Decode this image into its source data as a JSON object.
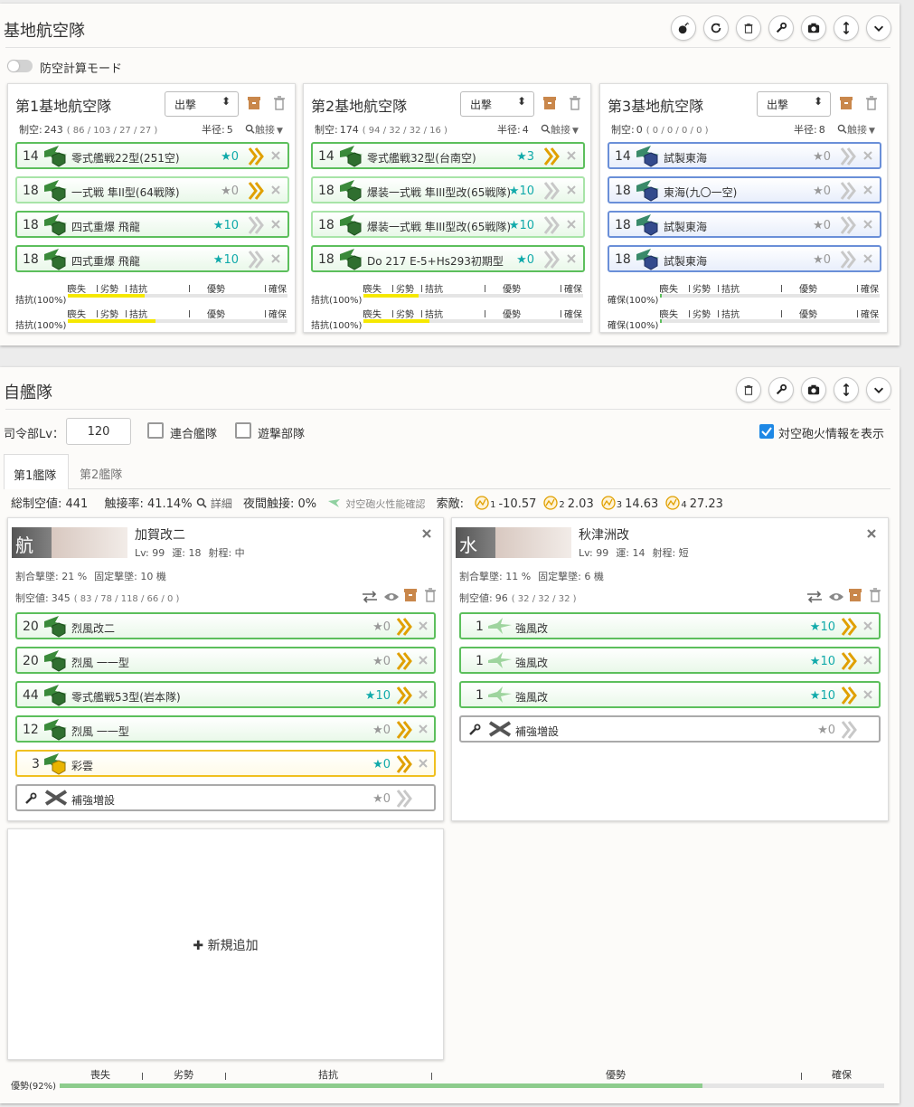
{
  "lbas": {
    "title": "基地航空隊",
    "aa_mode_label": "防空計算モード",
    "bases": [
      {
        "title": "第1基地航空隊",
        "mode": "出撃",
        "air_label": "制空:",
        "air": "243",
        "air_sub": "( 86 / 103 / 27 / 27 )",
        "radius_label": "半径:",
        "radius": "5",
        "contact": "触接",
        "slots": [
          {
            "count": "14",
            "name": "零式艦戦22型(251空)",
            "star": "★0",
            "type": "fighter",
            "tag": "戦"
          },
          {
            "count": "18",
            "name": "一式戦 隼II型(64戦隊)",
            "star": "★0",
            "type": "fighter",
            "tag": "陸"
          },
          {
            "count": "18",
            "name": "四式重爆 飛龍",
            "star": "★10",
            "type": "bomber",
            "tag": "陸"
          },
          {
            "count": "18",
            "name": "四式重爆 飛龍",
            "star": "★10",
            "type": "bomber",
            "tag": "陸"
          }
        ],
        "gauges": [
          {
            "status": "拮抗(100%)",
            "fill": 0.35
          },
          {
            "status": "拮抗(100%)",
            "fill": 0.4
          }
        ]
      },
      {
        "title": "第2基地航空隊",
        "mode": "出撃",
        "air_label": "制空:",
        "air": "174",
        "air_sub": "( 94 / 32 / 32 / 16 )",
        "radius_label": "半径:",
        "radius": "4",
        "contact": "触接",
        "slots": [
          {
            "count": "14",
            "name": "零式艦戦32型(台南空)",
            "star": "★3",
            "type": "fighter",
            "tag": "戦"
          },
          {
            "count": "18",
            "name": "爆装一式戦 隼III型改(65戦隊)",
            "star": "★10",
            "type": "fighter",
            "tag": "陸"
          },
          {
            "count": "18",
            "name": "爆装一式戦 隼III型改(65戦隊)",
            "star": "★10",
            "type": "fighter",
            "tag": "陸"
          },
          {
            "count": "18",
            "name": "Do 217 E-5+Hs293初期型",
            "star": "★0",
            "type": "bomber",
            "tag": "陸"
          }
        ],
        "gauges": [
          {
            "status": "拮抗(100%)",
            "fill": 0.25
          },
          {
            "status": "拮抗(100%)",
            "fill": 0.3
          }
        ]
      },
      {
        "title": "第3基地航空隊",
        "mode": "出撃",
        "air_label": "制空:",
        "air": "0",
        "air_sub": "( 0 / 0 / 0 / 0 )",
        "radius_label": "半径:",
        "radius": "8",
        "contact": "触接",
        "slots": [
          {
            "count": "14",
            "name": "試製東海",
            "star": "★0",
            "type": "patrol",
            "tag": "哨"
          },
          {
            "count": "18",
            "name": "東海(九〇一空)",
            "star": "★0",
            "type": "patrol",
            "tag": "哨"
          },
          {
            "count": "18",
            "name": "試製東海",
            "star": "★0",
            "type": "patrol",
            "tag": "哨"
          },
          {
            "count": "18",
            "name": "試製東海",
            "star": "★0",
            "type": "patrol",
            "tag": "哨"
          }
        ],
        "gauges": [
          {
            "status": "確保(100%)",
            "fill": 0.01
          },
          {
            "status": "確保(100%)",
            "fill": 0.01
          }
        ]
      }
    ],
    "gauge_labels": [
      "喪失",
      "劣勢",
      "拮抗",
      "優勢",
      "確保"
    ]
  },
  "fleet": {
    "title": "自艦隊",
    "hq_label": "司令部Lv：",
    "hq_value": "120",
    "combined_label": "連合艦隊",
    "striking_label": "遊撃部隊",
    "aa_info_label": "対空砲火情報を表示",
    "tabs": [
      "第1艦隊",
      "第2艦隊"
    ],
    "summary": {
      "air": "総制空値: 441",
      "contact": "触接率: 41.14%",
      "detail": "詳細",
      "night": "夜間触接: 0%",
      "aa_check": "対空砲火性能確認",
      "los_label": "索敵:",
      "los": [
        {
          "idx": "1",
          "val": "-10.57"
        },
        {
          "idx": "2",
          "val": "2.03"
        },
        {
          "idx": "3",
          "val": "14.63"
        },
        {
          "idx": "4",
          "val": "27.23"
        }
      ]
    },
    "ships": [
      {
        "name": "加賀改二",
        "lv": "Lv: 99",
        "luck": "運: 18",
        "range": "射程: 中",
        "shoot_rate": "割合撃墜: 21 %",
        "shoot_fixed": "固定撃墜: 10 機",
        "air_label": "制空値:",
        "air": "345",
        "air_sub": "( 83 / 78 / 118 / 66 / 0 )",
        "banner_char": "航",
        "slots": [
          {
            "count": "20",
            "name": "烈風改二",
            "star": "★0",
            "color": "green",
            "tag": "戦",
            "star_grey": true
          },
          {
            "count": "20",
            "name": "烈風 一一型",
            "star": "★0",
            "color": "green",
            "tag": "戦",
            "star_grey": true
          },
          {
            "count": "44",
            "name": "零式艦戦53型(岩本隊)",
            "star": "★10",
            "color": "green",
            "tag": "戦",
            "star_grey": false
          },
          {
            "count": "12",
            "name": "烈風 一一型",
            "star": "★0",
            "color": "green",
            "tag": "戦",
            "star_grey": true
          },
          {
            "count": "3",
            "name": "彩雲",
            "star": "★0",
            "color": "yellow",
            "tag": "偵",
            "star_grey": false
          }
        ],
        "expansion": {
          "name": "補強増設",
          "star": "★0"
        }
      },
      {
        "name": "秋津洲改",
        "lv": "Lv: 99",
        "luck": "運: 14",
        "range": "射程: 短",
        "shoot_rate": "割合撃墜: 11 %",
        "shoot_fixed": "固定撃墜: 6 機",
        "air_label": "制空値:",
        "air": "96",
        "air_sub": "( 32 / 32 / 32 )",
        "banner_char": "水",
        "slots": [
          {
            "count": "1",
            "name": "強風改",
            "star": "★10",
            "color": "green",
            "tag": "",
            "star_grey": false
          },
          {
            "count": "1",
            "name": "強風改",
            "star": "★10",
            "color": "green",
            "tag": "",
            "star_grey": false
          },
          {
            "count": "1",
            "name": "強風改",
            "star": "★10",
            "color": "green",
            "tag": "",
            "star_grey": false
          }
        ],
        "expansion": {
          "name": "補強増設",
          "star": "★0"
        }
      }
    ],
    "new_ship_label": "新規追加",
    "bottom_gauge": {
      "status": "優勢(92%)",
      "labels": [
        "喪失",
        "劣勢",
        "拮抗",
        "優勢",
        "確保"
      ],
      "fill": 0.78
    }
  },
  "colors": {
    "slot_green": "#5cbf5c",
    "slot_blue": "#6a8fd8",
    "slot_yellow": "#f0c020",
    "star_teal": "#1aa",
    "chevron_gold": "#e0a000",
    "gauge_yellow": "#f5e800",
    "gauge_green": "#8dcc8d"
  }
}
